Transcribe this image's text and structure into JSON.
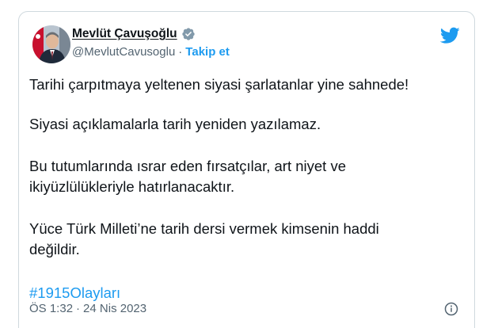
{
  "author": {
    "name": "Mevlüt Çavuşoğlu",
    "handle": "@MevlutCavusoglu",
    "separator": "·",
    "follow_label": "Takip et"
  },
  "tweet": {
    "line1": "Tarihi çarpıtmaya yeltenen siyasi şarlatanlar yine sahnede!",
    "line2": "Siyasi açıklamalarla tarih yeniden yazılamaz.",
    "line3a": "Bu tutumlarında ısrar eden fırsatçılar, art niyet ve",
    "line3b": "ikiyüzlülükleriyle hatırlanacaktır.",
    "line4a": "Yüce Türk Milleti’ne tarih dersi vermek kimsenin haddi",
    "line4b": "değildir.",
    "hashtag": "#1915Olayları"
  },
  "meta": {
    "time": "ÖS 1:32",
    "separator": "·",
    "date": "24 Nis 2023"
  },
  "icons": {
    "verified": "verified-badge-icon",
    "platform": "twitter-bird-icon",
    "info": "info-icon"
  },
  "colors": {
    "accent": "#1d9bf0",
    "secondary_text": "#536471",
    "border": "#cfd9de"
  }
}
